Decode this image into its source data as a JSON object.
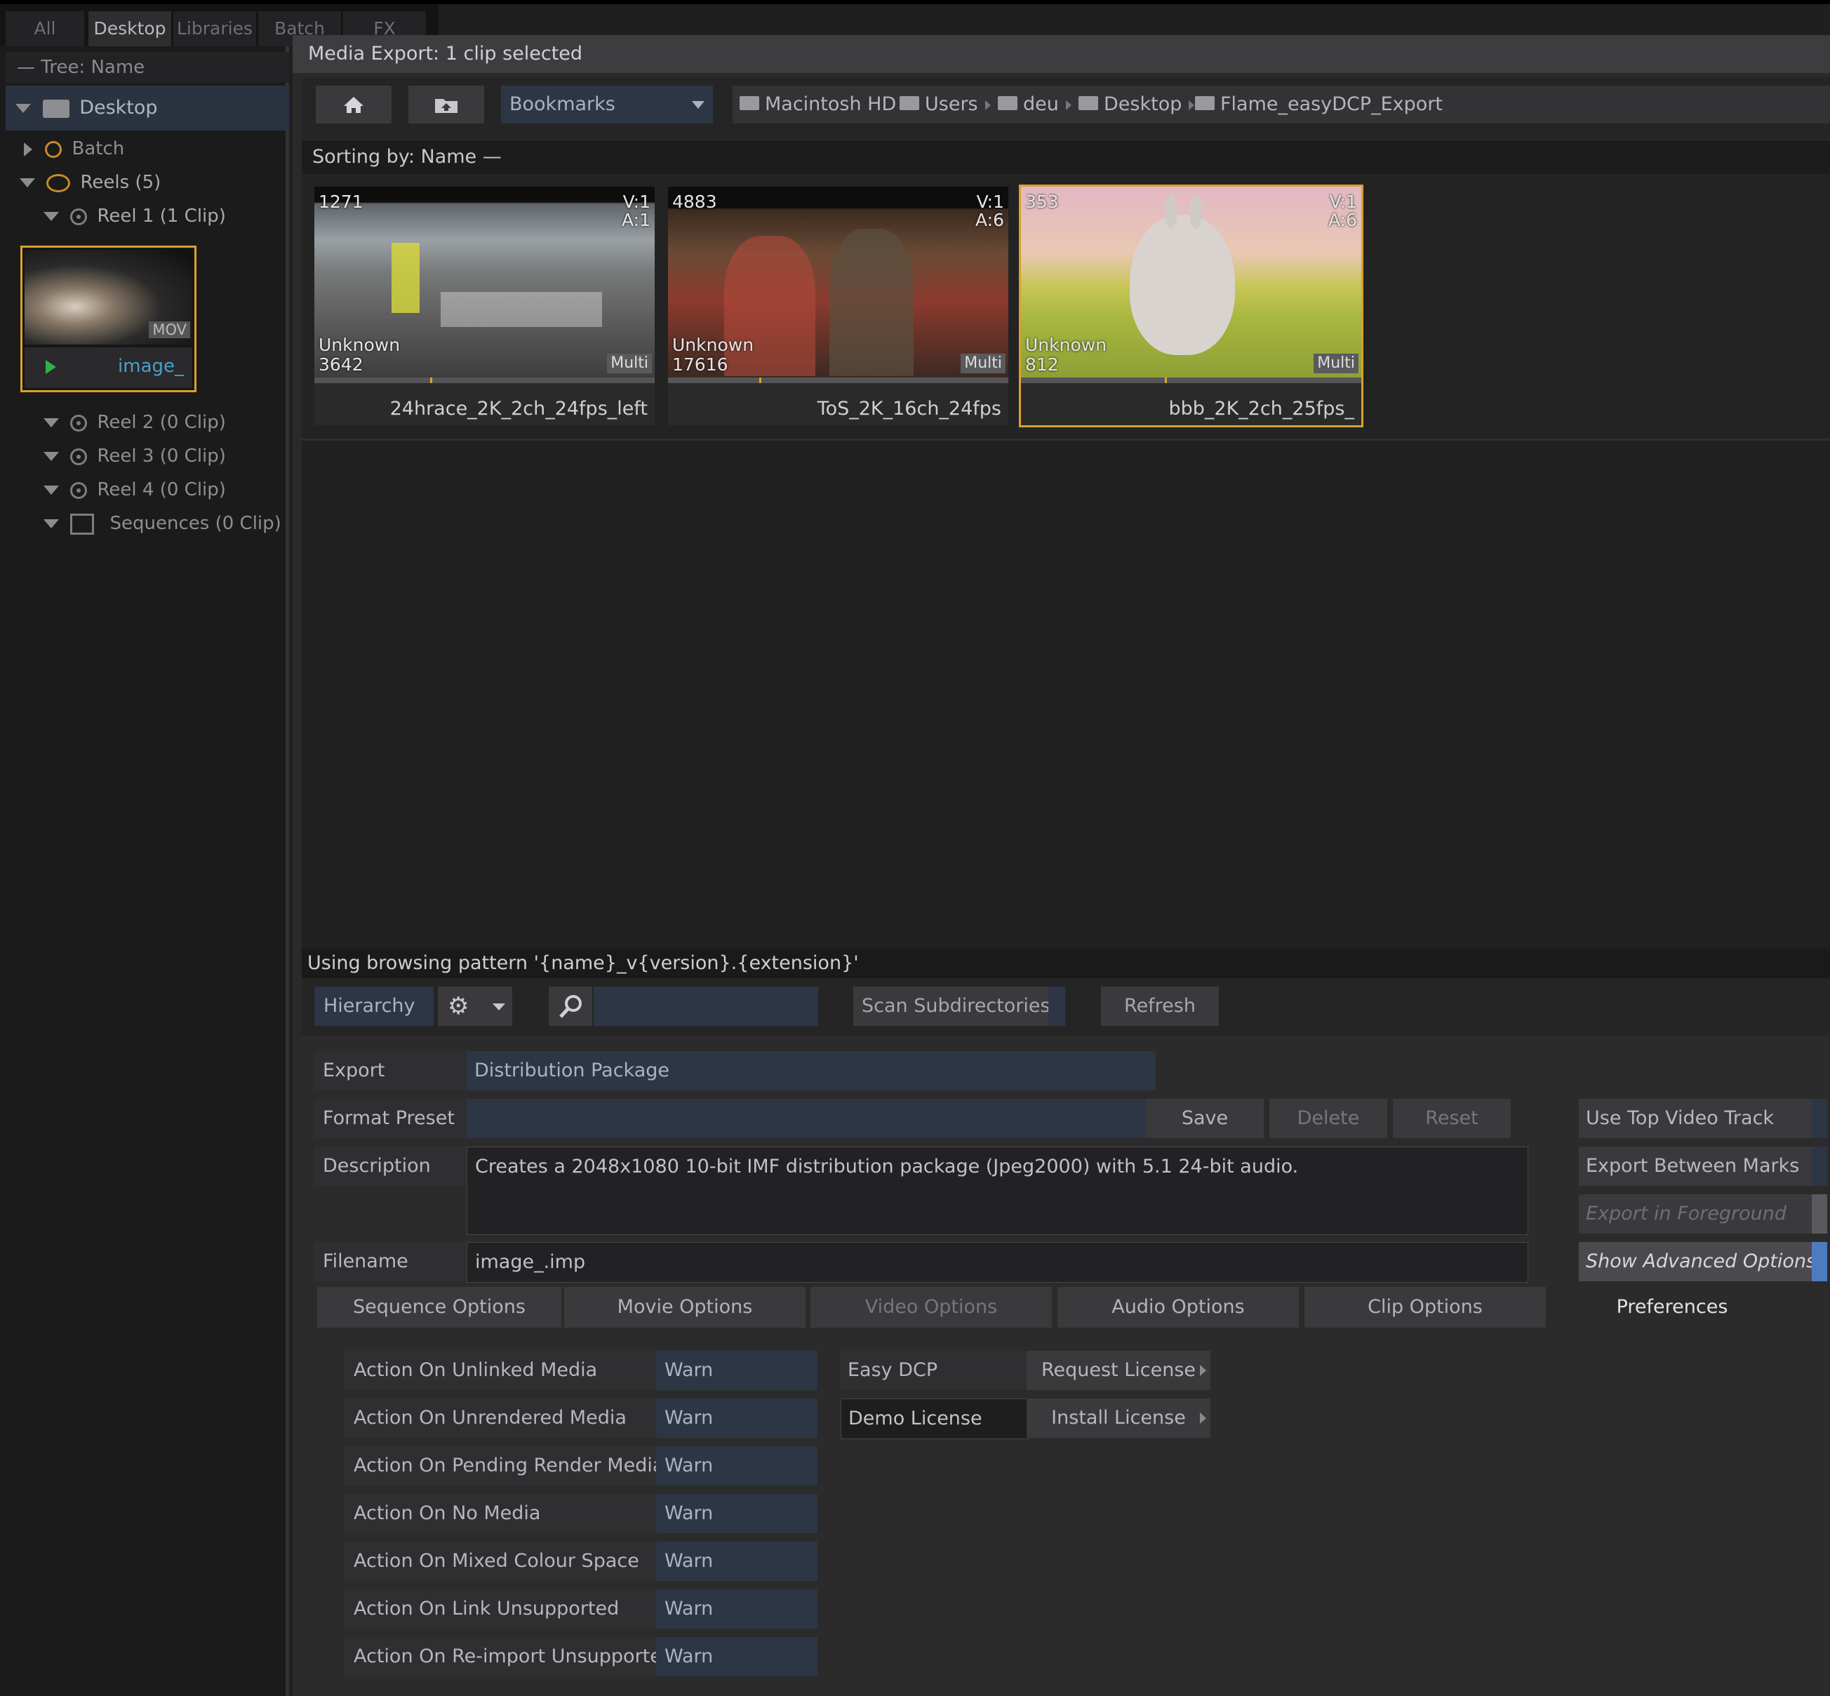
{
  "left_tabs": [
    "All",
    "Desktop",
    "Libraries",
    "Batch",
    "FX"
  ],
  "tree": {
    "header": "— Tree: Name",
    "desktop": "Desktop",
    "batch": "Batch",
    "reels": "Reels (5)",
    "reel1": "Reel 1 (1 Clip)",
    "reel2": "Reel 2 (0 Clip)",
    "reel3": "Reel 3 (0 Clip)",
    "reel4": "Reel 4 (0 Clip)",
    "sequences": "Sequences (0 Clip)",
    "mini_clip": {
      "badge": "MOV",
      "name": "image_"
    }
  },
  "window": {
    "title": "Media Export: 1 clip selected"
  },
  "nav": {
    "bookmarks": "Bookmarks",
    "path": [
      "Macintosh HD",
      "Users",
      "deu",
      "Desktop",
      "Flame_easyDCP_Export"
    ]
  },
  "sort_label": "Sorting by: Name —",
  "clips": [
    {
      "start": "1271",
      "tracks_v": "V:1",
      "tracks_a": "A:1",
      "res": "Unknown",
      "frames": "3642",
      "badge": "Multi",
      "name": "24hrace_2K_2ch_24fps_left"
    },
    {
      "start": "4883",
      "tracks_v": "V:1",
      "tracks_a": "A:6",
      "res": "Unknown",
      "frames": "17616",
      "badge": "Multi",
      "name": "ToS_2K_16ch_24fps"
    },
    {
      "start": "353",
      "tracks_v": "V:1",
      "tracks_a": "A:6",
      "res": "Unknown",
      "frames": "812",
      "badge": "Multi",
      "name": "bbb_2K_2ch_25fps_"
    }
  ],
  "pattern_text": "Using browsing pattern '{name}_v{version}.{extension}'",
  "toolbar": {
    "hierarchy": "Hierarchy",
    "search_placeholder": "",
    "scan": "Scan Subdirectories",
    "refresh": "Refresh"
  },
  "form": {
    "export_label": "Export",
    "export_value": "Distribution Package",
    "preset_label": "Format Preset",
    "preset_value": "",
    "save": "Save",
    "delete": "Delete",
    "reset": "Reset",
    "description_label": "Description",
    "description_value": "Creates a 2048x1080 10-bit IMF distribution package (Jpeg2000) with 5.1 24-bit audio.",
    "filename_label": "Filename",
    "filename_value": "image_.imp"
  },
  "options": {
    "top_video": "Use Top Video Track",
    "between_marks": "Export Between Marks",
    "foreground": "Export in Foreground",
    "advanced": "Show Advanced Options"
  },
  "tabs": [
    "Sequence Options",
    "Movie Options",
    "Video Options",
    "Audio Options",
    "Clip Options",
    "Preferences"
  ],
  "prefs": [
    {
      "label": "Action On Unlinked Media",
      "value": "Warn"
    },
    {
      "label": "Action On Unrendered Media",
      "value": "Warn"
    },
    {
      "label": "Action On Pending Render Media",
      "value": "Warn"
    },
    {
      "label": "Action On No Media",
      "value": "Warn"
    },
    {
      "label": "Action On Mixed Colour Space",
      "value": "Warn"
    },
    {
      "label": "Action On Link Unsupported",
      "value": "Warn"
    },
    {
      "label": "Action On Re-import Unsupported",
      "value": "Warn"
    }
  ],
  "license": {
    "label": "Easy DCP",
    "request": "Request License",
    "status": "Demo License",
    "install": "Install License"
  },
  "colors": {
    "accent_selection": "#d9a22a",
    "field_blue": "#2c3644",
    "advanced_toggle": "#4e7bc0"
  }
}
